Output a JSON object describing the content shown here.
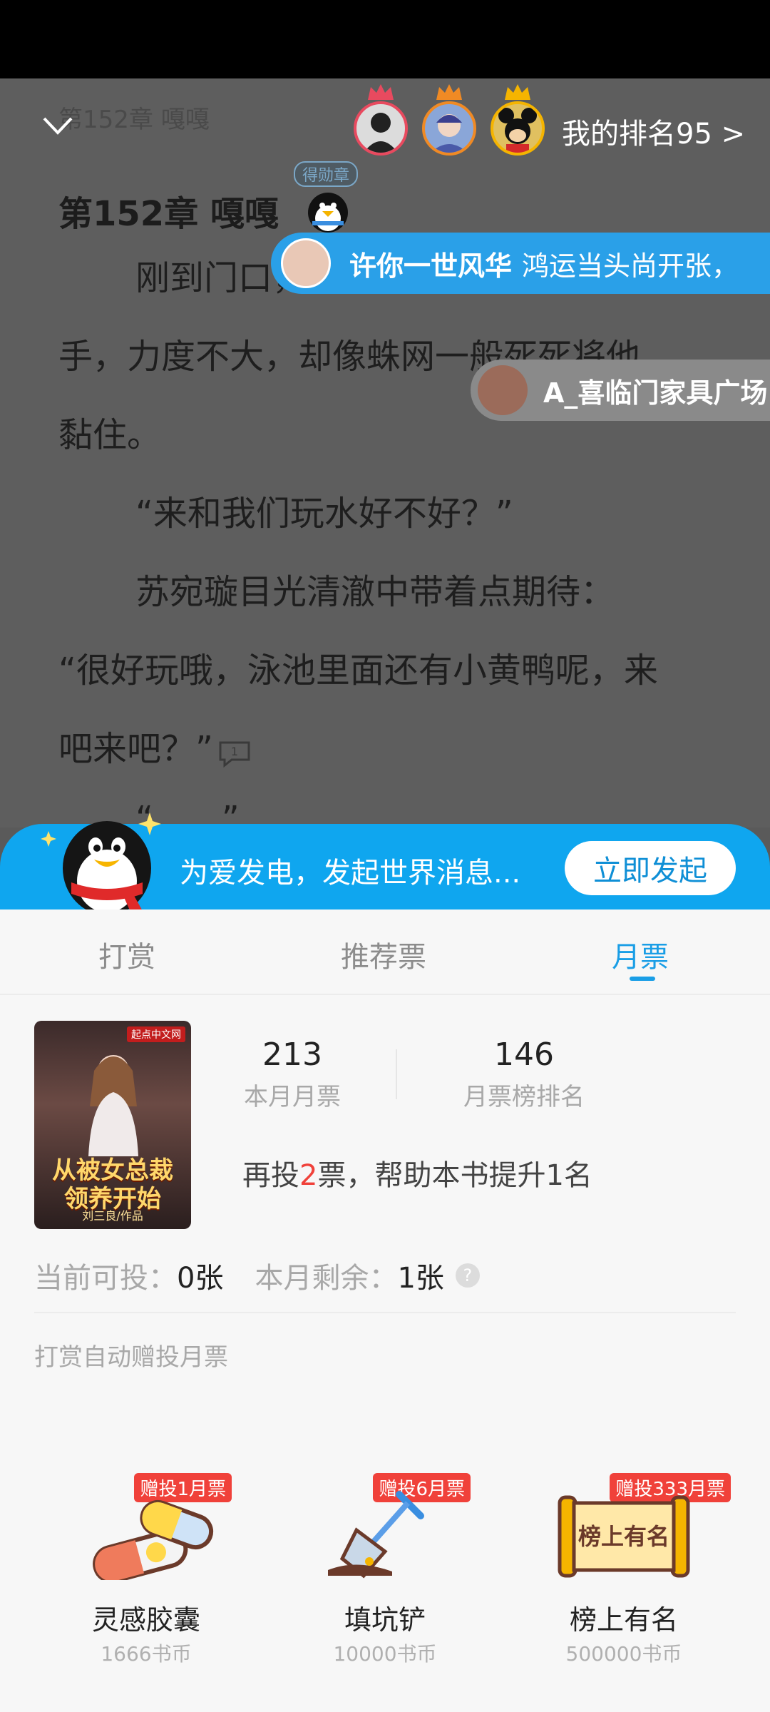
{
  "reader": {
    "faded_header": "第152章 嘎嘎",
    "chapter_title": "第152章 嘎嘎",
    "medal_badge": "得勋章",
    "lines": [
      "刚到门口，苏宛璇就抓住了他的",
      "手，力度不大，却像蛛网一般死死将他",
      "黏住。",
      "“来和我们玩水好不好？”",
      "苏宛璇目光清澈中带着点期待：",
      "“很好玩哦，泳池里面还有小黄鸭呢，来",
      "吧来吧？”",
      "“……”"
    ],
    "comment_count": "1"
  },
  "top": {
    "my_rank": "我的排名95 >"
  },
  "danmaku": [
    {
      "name": "许你一世风华",
      "message": "鸿运当头尚开张，"
    },
    {
      "name": "A_喜临门家具广场",
      "message": ""
    }
  ],
  "promo": {
    "text": "为爱发电，发起世界消息...",
    "button": "立即发起"
  },
  "tabs": [
    "打赏",
    "推荐票",
    "月票"
  ],
  "book": {
    "cover_logo": "起点中文网",
    "cover_title_line1": "从被女总裁",
    "cover_title_line2": "领养开始",
    "cover_author": "刘三良/作品"
  },
  "stats": {
    "monthly_votes": "213",
    "monthly_votes_label": "本月月票",
    "rank": "146",
    "rank_label": "月票榜排名"
  },
  "boost": {
    "prefix": "再投",
    "count": "2",
    "suffix": "票，帮助本书提升1名"
  },
  "votes": {
    "current_label": "当前可投：",
    "current_value": "0张",
    "remain_label": "本月剩余：",
    "remain_value": "1张",
    "help": "?"
  },
  "auto_note": "打赏自动赠投月票",
  "gifts": [
    {
      "tag": "赠投1月票",
      "name": "灵感胶囊",
      "price": "1666书币"
    },
    {
      "tag": "赠投6月票",
      "name": "填坑铲",
      "price": "10000书币"
    },
    {
      "tag": "赠投333月票",
      "name": "榜上有名",
      "price": "500000书币",
      "scroll_text": "榜上有名"
    }
  ],
  "colors": {
    "accent_blue": "#1a9ee6",
    "promo_blue": "#0fa6ef",
    "highlight_red": "#f0413a"
  }
}
